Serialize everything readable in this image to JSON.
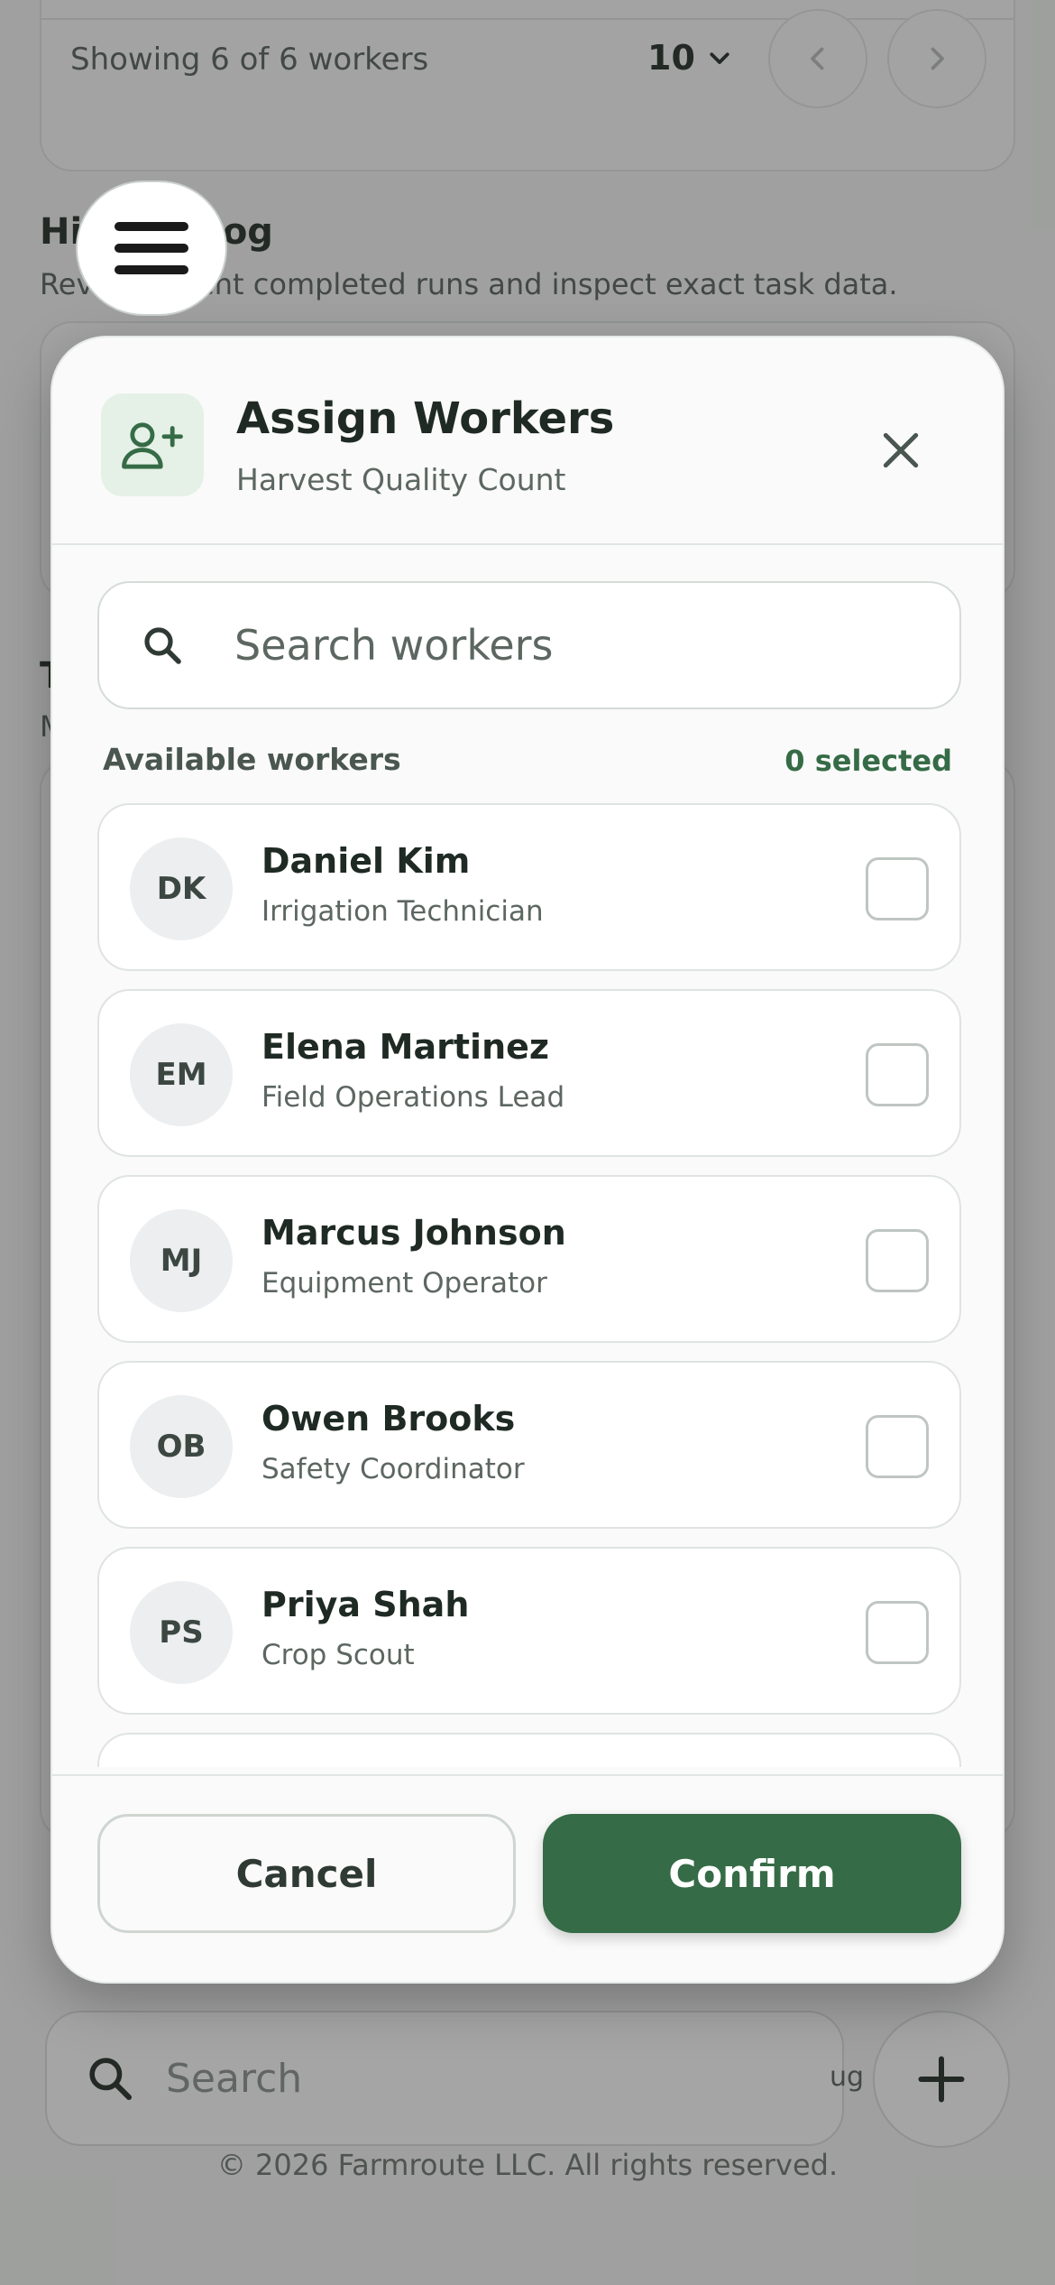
{
  "background": {
    "pager": {
      "showing_text": "Showing 6 of 6 workers",
      "page_size": "10"
    },
    "history": {
      "title": "History Log",
      "subtitle": "Review recent completed runs and inspect exact task data."
    },
    "partial_heading_letter": "T",
    "partial_sub_letter": "M",
    "search_placeholder": "Search",
    "partial_tag": "ug",
    "footer": "© 2026 Farmroute LLC. All rights reserved."
  },
  "modal": {
    "title": "Assign Workers",
    "subtitle": "Harvest Quality Count",
    "search_placeholder": "Search workers",
    "available_label": "Available workers",
    "selected_count": "0 selected",
    "workers": [
      {
        "initials": "DK",
        "name": "Daniel Kim",
        "role": "Irrigation Technician",
        "selected": false
      },
      {
        "initials": "EM",
        "name": "Elena Martinez",
        "role": "Field Operations Lead",
        "selected": false
      },
      {
        "initials": "MJ",
        "name": "Marcus Johnson",
        "role": "Equipment Operator",
        "selected": false
      },
      {
        "initials": "OB",
        "name": "Owen Brooks",
        "role": "Safety Coordinator",
        "selected": false
      },
      {
        "initials": "PS",
        "name": "Priya Shah",
        "role": "Crop Scout",
        "selected": false
      }
    ],
    "cancel_label": "Cancel",
    "confirm_label": "Confirm"
  },
  "icons": {
    "menu": "menu-icon",
    "search": "search-icon",
    "add": "plus-icon",
    "assign": "user-plus-icon",
    "close": "close-icon",
    "chevron_down": "chevron-down-icon",
    "chevron_left": "chevron-left-icon",
    "chevron_right": "chevron-right-icon"
  },
  "colors": {
    "accent": "#356b46",
    "accent_soft": "#e5f1e7"
  }
}
